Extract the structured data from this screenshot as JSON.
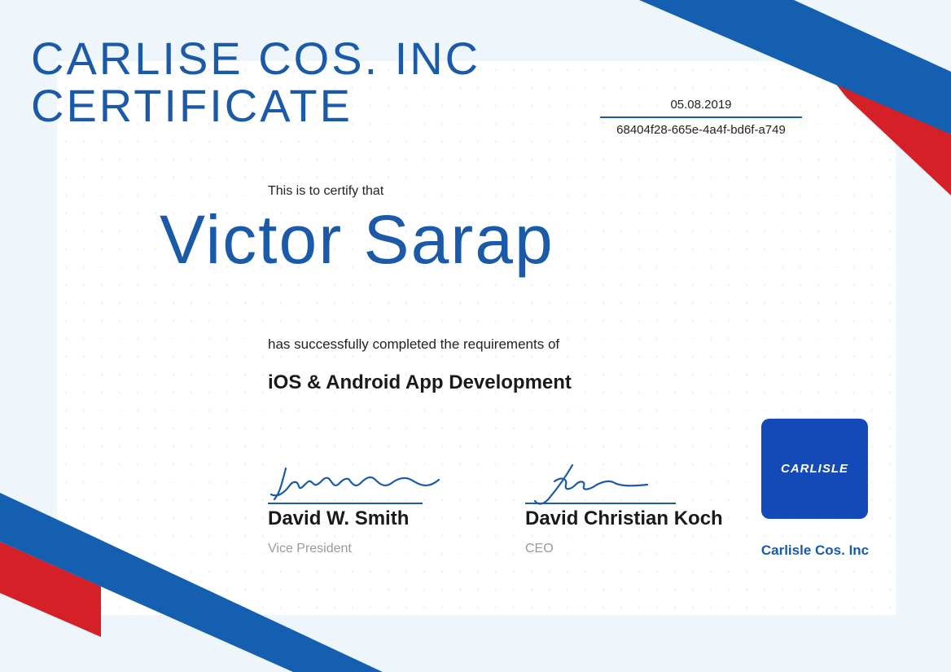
{
  "title_line_1": "CARLISE COS. INC",
  "title_line_2": "CERTIFICATE",
  "date": "05.08.2019",
  "certificate_id": "68404f28-665e-4a4f-bd6f-a749",
  "intro": "This is to certify that",
  "recipient": "Victor Sarap",
  "completed_text": "has successfully completed the requirements of",
  "course": "iOS & Android App Development",
  "signatories": [
    {
      "name": "David W. Smith",
      "role": "Vice President"
    },
    {
      "name": "David Christian Koch",
      "role": "CEO"
    }
  ],
  "logo_text": "CARLISLE",
  "company_name": "Carlisle Cos. Inc",
  "colors": {
    "primary_blue": "#1b5aa8",
    "ribbon_blue": "#155fb0",
    "ribbon_red": "#d62027",
    "logo_bg": "#1449b8",
    "background": "#eef6fc"
  }
}
